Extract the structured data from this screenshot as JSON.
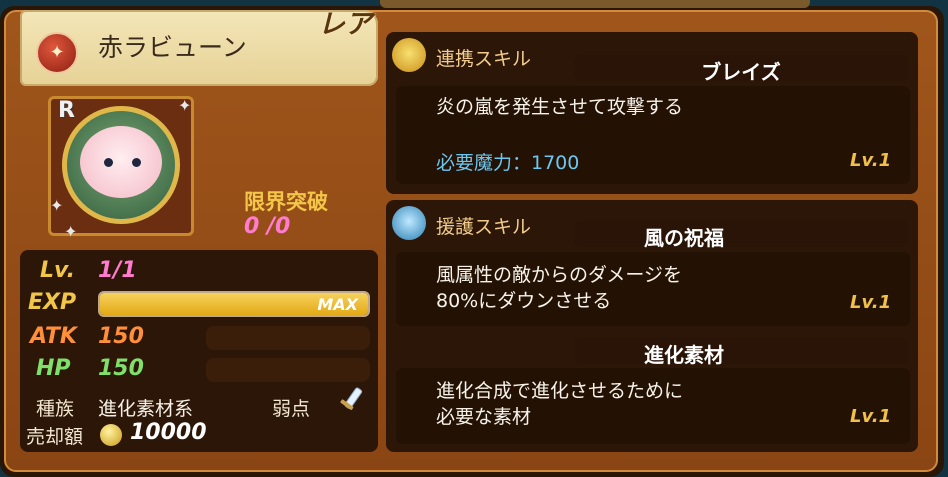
{
  "unit": {
    "name": "赤ラビューン",
    "rarity": "レア",
    "rank_badge": "R",
    "element_icon": "fire-emblem-icon"
  },
  "limit_break": {
    "label": "限界突破",
    "value": "0 /0"
  },
  "stats": {
    "lv_label": "Lv.",
    "lv_value": "1/1",
    "exp_label": "EXP",
    "exp_text": "MAX",
    "exp_fill": 1.0,
    "atk_label": "ATK",
    "atk_value": "150",
    "hp_label": "HP",
    "hp_value": "150",
    "race_label": "種族",
    "race_value": "進化素材系",
    "weak_label": "弱点",
    "weak_icon": "sword-icon",
    "sell_label": "売却額",
    "sell_value": "10000"
  },
  "link_skill": {
    "title": "連携スキル",
    "name": "ブレイズ",
    "description": "炎の嵐を発生させて攻撃する",
    "mana_text": "必要魔力：1700",
    "level": "Lv.1"
  },
  "support_skill": {
    "title": "援護スキル",
    "name": "風の祝福",
    "description_line1": "風属性の敵からのダメージを",
    "description_line2": "80%にダウンさせる",
    "level": "Lv.1"
  },
  "evolution": {
    "name": "進化素材",
    "description_line1": "進化合成で進化させるために",
    "description_line2": "必要な素材",
    "level": "Lv.1"
  },
  "colors": {
    "panel": "#9a5119",
    "gold_text": "#f2c648",
    "pink_text": "#ff7ccf",
    "mana_blue": "#6cc7f0"
  }
}
